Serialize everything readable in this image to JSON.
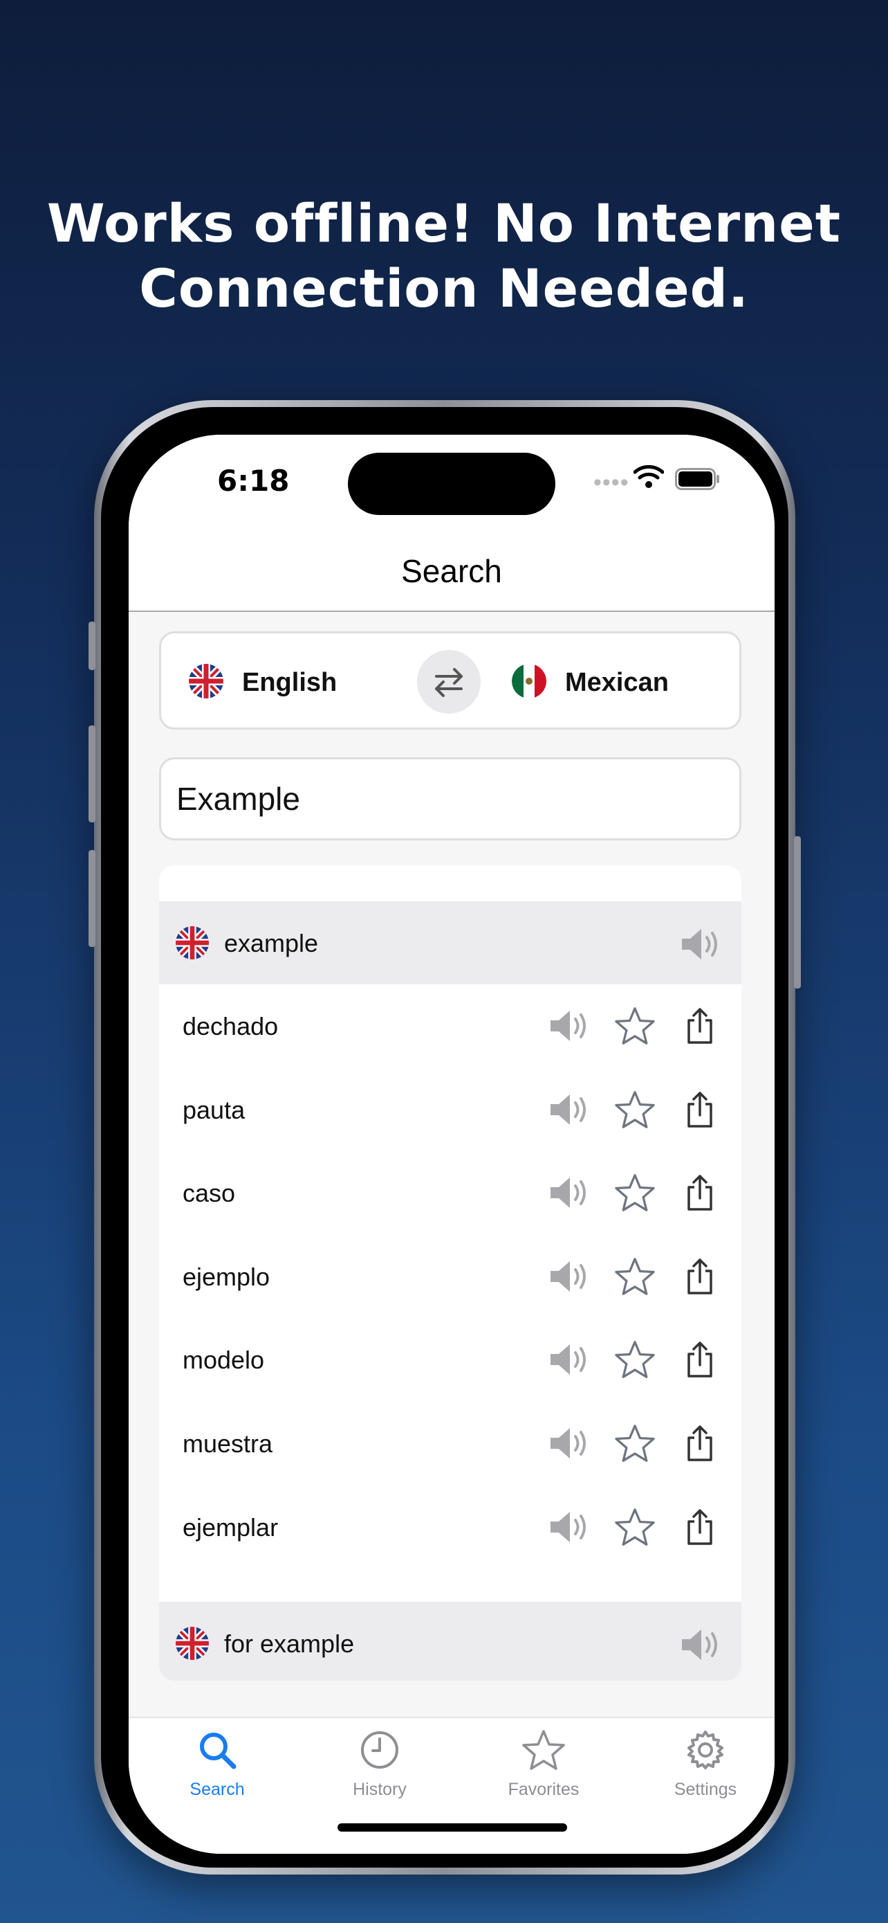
{
  "headline": {
    "line1": "Works offline! No Internet",
    "line2": "Connection Needed."
  },
  "status_bar": {
    "time": "6:18",
    "signal_dots": "••••"
  },
  "nav": {
    "title": "Search"
  },
  "languages": {
    "source": {
      "label": "English",
      "flag": "uk-flag-icon"
    },
    "target": {
      "label": "Mexican",
      "flag": "mexico-flag-icon"
    },
    "swap_icon": "swap-arrows-icon"
  },
  "search": {
    "value": "Example"
  },
  "results": [
    {
      "term": "example",
      "translations": [
        "dechado",
        "pauta",
        "caso",
        "ejemplo",
        "modelo",
        "muestra",
        "ejemplar"
      ]
    },
    {
      "term": "for example",
      "translations": []
    }
  ],
  "tabs": [
    {
      "label": "Search",
      "icon": "magnifier-icon",
      "active": true
    },
    {
      "label": "History",
      "icon": "clock-icon",
      "active": false
    },
    {
      "label": "Favorites",
      "icon": "star-icon",
      "active": false
    },
    {
      "label": "Settings",
      "icon": "gear-icon",
      "active": false
    }
  ],
  "colors": {
    "accent": "#1a7cf0",
    "inactive_tab": "#8e8e93",
    "icon_gray": "#a8a8ac",
    "star_gray": "#6f7580"
  }
}
